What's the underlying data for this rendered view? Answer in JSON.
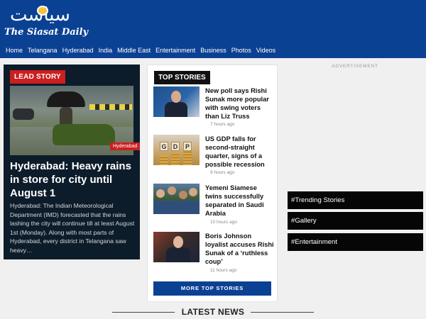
{
  "header": {
    "logo_urdu": "سیاست",
    "logo_english": "The Siasat Daily",
    "nav": [
      "Home",
      "Telangana",
      "Hyderabad",
      "India",
      "Middle East",
      "Entertainment",
      "Business",
      "Photos",
      "Videos"
    ]
  },
  "lead_story": {
    "tag": "LEAD STORY",
    "category": "Hyderabad",
    "title": "Hyderabad: Heavy rains in store for city until August 1",
    "summary": "Hyderabad: The Indian Meteorological Department (IMD) forecasted that the rains lashing the city will continue till at least August 1st (Monday). Along with most parts of Hyderabad, every district in Telangana saw heavy…"
  },
  "top_stories": {
    "tag": "TOP STORIES",
    "items": [
      {
        "headline": "New poll says Rishi Sunak more popular with swing voters than Liz Truss",
        "time": "7 hours ago"
      },
      {
        "headline": "US GDP falls for second-straight quarter, signs of a possible recession",
        "time": "9 hours ago"
      },
      {
        "headline": "Yemeni Siamese twins successfully separated in Saudi Arabia",
        "time": "10 hours ago"
      },
      {
        "headline": "Boris Johnson loyalist accuses Rishi Sunak of a ‘ruthless coup’",
        "time": "11 hours ago"
      }
    ],
    "more_button": "MORE TOP STORIES",
    "gdp_letters": [
      "G",
      "D",
      "P"
    ]
  },
  "sidebar": {
    "ad_label": "ADVERTISEMENT",
    "links": [
      "#Trending Stories",
      "#Gallery",
      "#Entertainment"
    ]
  },
  "latest_news": {
    "label": "LATEST NEWS"
  },
  "colors": {
    "brand_blue": "#0b4193",
    "lead_bg": "#0d1c2a",
    "accent_red": "#cc1f1f"
  }
}
